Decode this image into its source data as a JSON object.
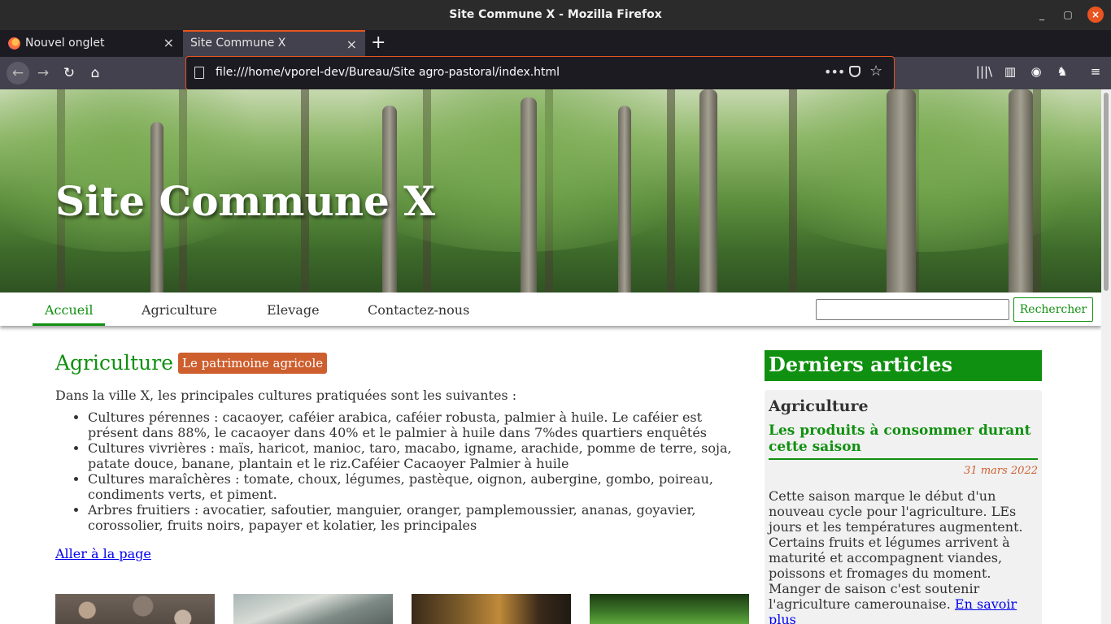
{
  "window": {
    "title": "Site Commune X - Mozilla Firefox",
    "minimize_glyph": "_",
    "maximize_glyph": "▢",
    "close_glyph": "×"
  },
  "tabs": [
    {
      "label": "Nouvel onglet",
      "close_glyph": "×",
      "active": false
    },
    {
      "label": "Site Commune X",
      "close_glyph": "×",
      "active": true
    }
  ],
  "toolbar": {
    "new_tab_glyph": "+",
    "back_glyph": "←",
    "forward_glyph": "→",
    "reload_glyph": "↻",
    "home_glyph": "⌂",
    "url": "file:///home/vporel-dev/Bureau/Site agro-pastoral/index.html",
    "more_glyph": "•••",
    "star_glyph": "☆",
    "library_glyph": "|||\\",
    "sidebar_glyph": "▥",
    "account_glyph": "◉",
    "extension_glyph": "♞",
    "menu_glyph": "≡",
    "icons": [
      "page-icon",
      "more-actions-icon",
      "pocket-icon",
      "bookmark-star-icon",
      "library-icon",
      "sidebar-icon",
      "account-icon",
      "extension-icon",
      "hamburger-menu-icon"
    ]
  },
  "site": {
    "title": "Site Commune X",
    "nav": [
      "Accueil",
      "Agriculture",
      "Elevage",
      "Contactez-nous"
    ],
    "active_nav": "Accueil",
    "search_value": "",
    "search_button": "Rechercher",
    "accent_color": "#109010",
    "badge_color": "#cd5e2e"
  },
  "main": {
    "heading": "Agriculture",
    "badge": "Le patrimoine agricole",
    "intro": "Dans la ville X, les principales cultures pratiquées sont les suivantes :",
    "items": [
      "Cultures pérennes : cacaoyer, caféier arabica, caféier robusta, palmier à huile. Le caféier est présent dans 88%, le cacaoyer dans 40% et le palmier à huile dans 7%des quartiers enquêtés",
      "Cultures vivrières : maïs, haricot, manioc, taro, macabo, igname, arachide, pomme de terre, soja, patate douce, banane, plantain et le riz.Caféier Cacaoyer Palmier à huile",
      "Cultures maraîchères : tomate, choux, légumes, pastèque, oignon, aubergine, gombo, poireau, condiments verts, et piment.",
      "Arbres fruitiers : avocatier, safoutier, manguier, oranger, pamplemoussier, ananas, goyavier, corossolier, fruits noirs, papayer et kolatier, les principales"
    ],
    "link": "Aller à la page"
  },
  "sidebar": {
    "heading": "Derniers articles",
    "article": {
      "category": "Agriculture",
      "title": "Les produits à consommer durant cette saison",
      "date": "31 mars 2022",
      "body": "Cette saison marque le début d'un nouveau cycle pour l'agriculture. LEs jours et les températures augmentent. Certains fruits et légumes arrivent à maturité et accompagnent viandes, poissons et fromages du moment. Manger de saison c'est soutenir l'agriculture camerounaise. ",
      "link": "En savoir plus"
    }
  }
}
